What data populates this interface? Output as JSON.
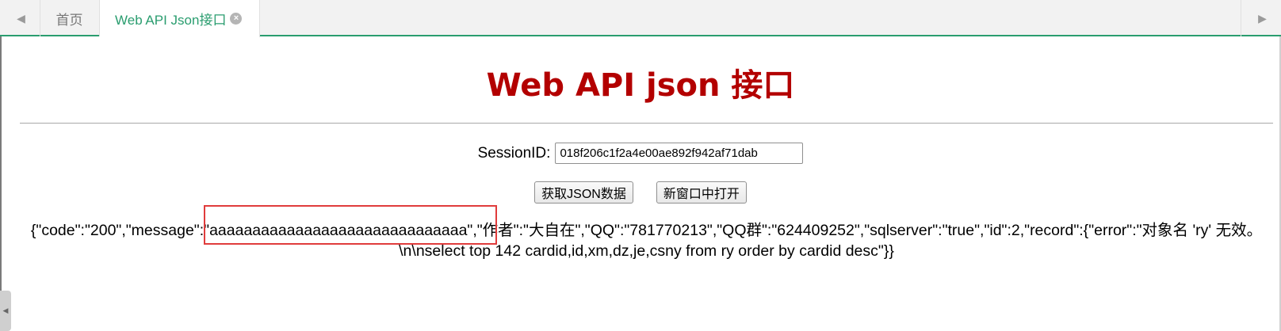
{
  "tabs": {
    "nav_prev_icon": "◀",
    "nav_next_icon": "▶",
    "home_label": "首页",
    "active_label": "Web API Json接口",
    "close_icon": "×",
    "accent_color": "#2a9d6f"
  },
  "page": {
    "title": "Web API json 接口",
    "title_color": "#b30000",
    "session_label": "SessionID:",
    "session_value": "018f206c1f2a4e00ae892f942af71dab",
    "get_json_button": "获取JSON数据",
    "open_new_window_button": "新窗口中打开",
    "json_output": "{\"code\":\"200\",\"message\":\"aaaaaaaaaaaaaaaaaaaaaaaaaaaaaa\",\"作者\":\"大自在\",\"QQ\":\"781770213\",\"QQ群\":\"624409252\",\"sqlserver\":\"true\",\"id\":2,\"record\":{\"error\":\"对象名 'ry' 无效。\\n\\nselect top 142 cardid,id,xm,dz,je,csny from ry order by cardid desc\"}}",
    "highlight_color": "#e03c3c"
  },
  "side_handle_icon": "◀"
}
